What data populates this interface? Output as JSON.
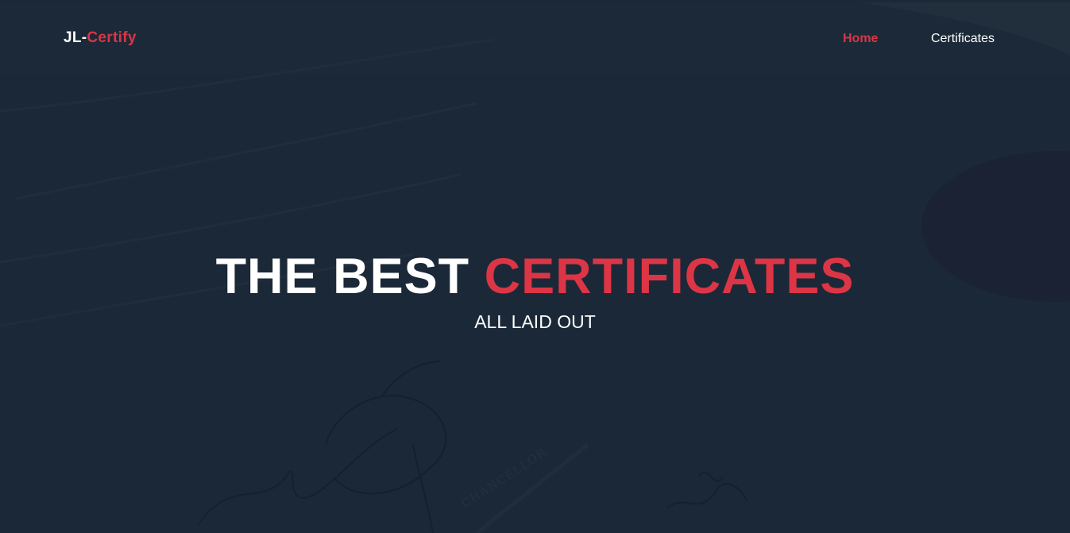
{
  "navbar": {
    "brand_part1": "JL-",
    "brand_part2": "Certify",
    "links": [
      {
        "label": "Home",
        "active": true
      },
      {
        "label": "Certificates",
        "active": false
      }
    ]
  },
  "hero": {
    "title_part1": "THE BEST ",
    "title_part2": "CERTIFICATES",
    "subtitle": "ALL LAID OUT"
  },
  "background": {
    "image": "faded certificate with signatures and seal",
    "seal_label": "CHANCELLOR"
  },
  "colors": {
    "background": "#1b2838",
    "accent": "#dc3545",
    "text": "#ffffff"
  }
}
